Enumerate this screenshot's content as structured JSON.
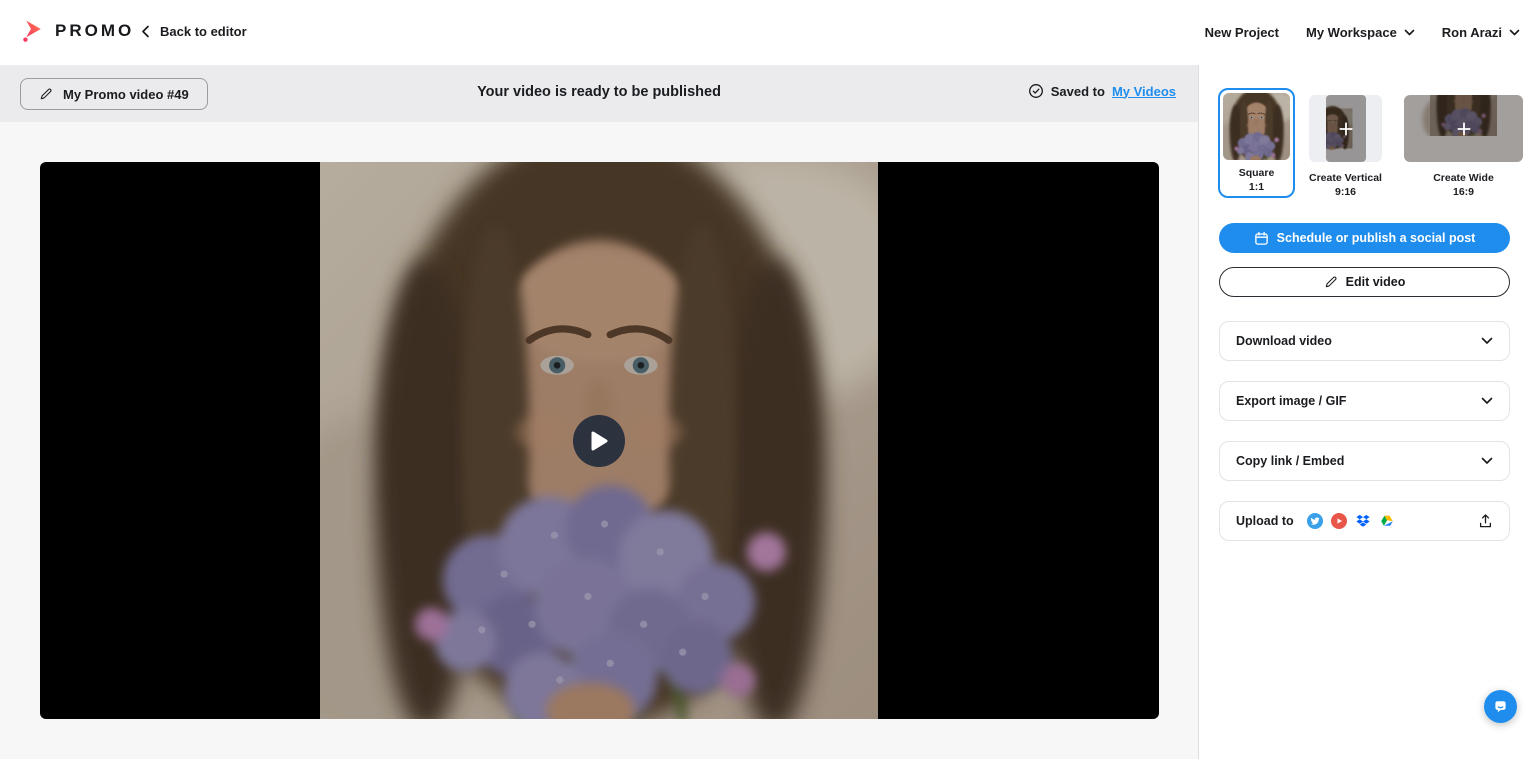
{
  "app": {
    "brand": "PROMO"
  },
  "topnav": {
    "back": "Back to editor",
    "new_project": "New Project",
    "workspace": "My Workspace",
    "user": "Ron Arazi"
  },
  "banner": {
    "video_name": "My Promo video #49",
    "message": "Your video is ready to be published",
    "saved_prefix": "Saved to",
    "saved_link": "My Videos"
  },
  "formats": [
    {
      "label": "Square",
      "ratio": "1:1",
      "selected": true
    },
    {
      "label": "Create Vertical",
      "ratio": "9:16",
      "selected": false
    },
    {
      "label": "Create Wide",
      "ratio": "16:9",
      "selected": false
    }
  ],
  "actions": {
    "schedule": "Schedule or publish a social post",
    "edit": "Edit video"
  },
  "sections": [
    {
      "label": "Download video"
    },
    {
      "label": "Export image / GIF"
    },
    {
      "label": "Copy link / Embed"
    }
  ],
  "upload": {
    "label": "Upload to",
    "targets": [
      "twitter",
      "youtube",
      "dropbox",
      "google-drive"
    ]
  },
  "colors": {
    "accent": "#1f8ded",
    "brand_pink": "#f93a5f",
    "banner_bg": "#ebebee",
    "stage_bg": "#f7f7f8"
  }
}
